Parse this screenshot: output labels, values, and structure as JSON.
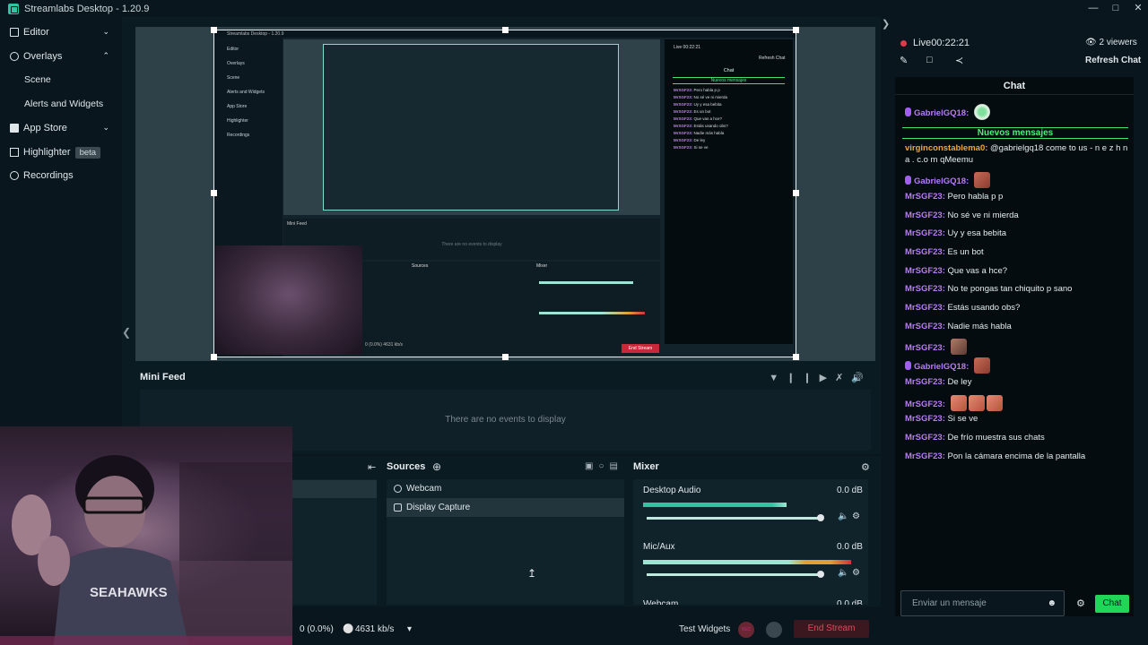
{
  "window": {
    "title": "Streamlabs Desktop - 1.20.9"
  },
  "sidebar": {
    "items": [
      {
        "label": "Editor"
      },
      {
        "label": "Overlays"
      },
      {
        "label": "Scene"
      },
      {
        "label": "Alerts and Widgets"
      },
      {
        "label": "App Store"
      },
      {
        "label": "Highlighter",
        "badge": "beta"
      },
      {
        "label": "Recordings"
      }
    ]
  },
  "stream": {
    "live_label": "Live",
    "time": "00:22:21",
    "viewers": "2 viewers",
    "refresh_label": "Refresh Chat"
  },
  "chat": {
    "title": "Chat",
    "new_messages": "Nuevos mensajes",
    "input_placeholder": "Enviar un mensaje",
    "send_label": "Chat",
    "messages": [
      {
        "user": "GabrielGQ18:",
        "text": ""
      },
      {
        "user": "virginconstablema0:",
        "text": "@gabrielgq18 come to us - n e z h n a . c.o m qMeemu"
      },
      {
        "user": "GabrielGQ18:",
        "text": ""
      },
      {
        "user": "MrSGF23:",
        "text": "Pero habla p p"
      },
      {
        "user": "MrSGF23:",
        "text": "No sé ve ni mierda"
      },
      {
        "user": "MrSGF23:",
        "text": "Uy y esa bebita"
      },
      {
        "user": "MrSGF23:",
        "text": "Es un bot"
      },
      {
        "user": "MrSGF23:",
        "text": "Que vas a hce?"
      },
      {
        "user": "MrSGF23:",
        "text": "No te pongas tan chiquito p sano"
      },
      {
        "user": "MrSGF23:",
        "text": "Estás usando obs?"
      },
      {
        "user": "MrSGF23:",
        "text": "Nadie más habla"
      },
      {
        "user": "MrSGF23:",
        "text": ""
      },
      {
        "user": "GabrielGQ18:",
        "text": ""
      },
      {
        "user": "MrSGF23:",
        "text": "De ley"
      },
      {
        "user": "MrSGF23:",
        "text": ""
      },
      {
        "user": "MrSGF23:",
        "text": "Si se ve"
      },
      {
        "user": "MrSGF23:",
        "text": "De frío muestra sus chats"
      },
      {
        "user": "MrSGF23:",
        "text": "Pon la cámara encima de la pantalla"
      }
    ]
  },
  "minifeed": {
    "title": "Mini Feed",
    "empty": "There are no events to display"
  },
  "sources": {
    "title": "Sources",
    "items": [
      {
        "label": "Webcam"
      },
      {
        "label": "Display Capture"
      }
    ]
  },
  "mixer": {
    "title": "Mixer",
    "channels": [
      {
        "name": "Desktop Audio",
        "db": "0.0 dB"
      },
      {
        "name": "Mic/Aux",
        "db": "0.0 dB"
      },
      {
        "name": "Webcam",
        "db": "0.0 dB"
      }
    ]
  },
  "footer": {
    "dropped": "0 (0.0%)",
    "bitrate": "4631 kb/s",
    "test_widgets": "Test Widgets",
    "rec": "REC",
    "end_stream": "End Stream"
  },
  "nested": {
    "title": "Streamlabs Desktop - 1.20.9",
    "live": "Live 00:22:21",
    "refresh": "Refresh Chat",
    "minifeed": "Mini Feed",
    "empty": "There are no events to display",
    "sources": "Sources",
    "mixer": "Mixer",
    "footer": "0 (0.0%)   4631 kb/s",
    "end_stream": "End Stream"
  },
  "colors": {
    "accent": "#31c3a2",
    "live": "#e0394a",
    "chat_user": "#b77cf5",
    "chat_user_alt": "#f0a63d",
    "new_messages": "#4ff07a",
    "send": "#21d657"
  }
}
